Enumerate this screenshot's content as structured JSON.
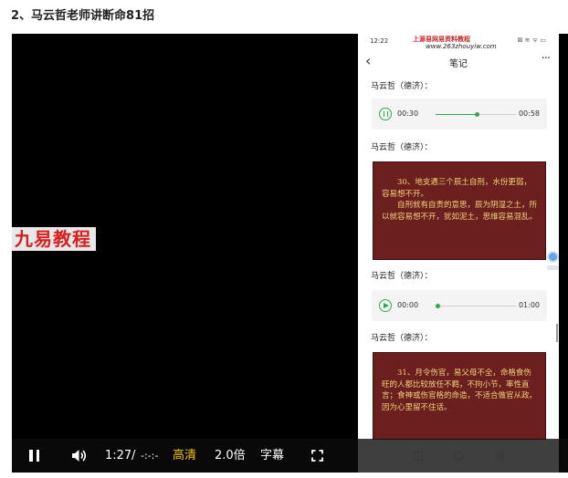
{
  "heading": "2、马云哲老师讲断命81招",
  "watermark": "九易教程",
  "phone": {
    "status_time": "12:22",
    "status_icons": "⊠ ≋ ᯤ ▭",
    "site_banner": "上源易网易资料教程",
    "site_url": "www.263zhouyiw.com",
    "nav_title": "笔记",
    "back_icon": "‹",
    "more_icon": "···",
    "author_label": "马云哲（德济）：",
    "audio1": {
      "current": "00:30",
      "duration": "00:58",
      "progress": 0.517,
      "state": "paused-icon"
    },
    "audio2": {
      "current": "00:00",
      "duration": "01:00",
      "progress": 0.0,
      "state": "play-icon"
    },
    "note1": [
      "30、地支遇三个辰土自刑，水份更弱，容易想不开。",
      "自刑就有自责的意思，辰为阴湿之土，所以就容易想不开，犹如泥土，思维容易混乱。"
    ],
    "note2": [
      "31、月令伤官，易父母不全，命格食伤旺的人都比较放任不羁，不拘小节，率性直言；食神或伤官格的命造，不适合做官从政。因为心里留不住话。"
    ],
    "nav_buttons": [
      "□",
      "○",
      "◁"
    ]
  },
  "controls": {
    "time": "1:27",
    "separator": "/",
    "duration": "-:-:-",
    "quality": "高清",
    "speed": "2.0倍",
    "subtitle": "字幕",
    "quality_color": "#f5c518"
  }
}
